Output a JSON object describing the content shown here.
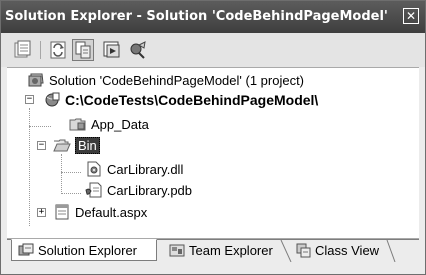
{
  "window": {
    "title": "Solution Explorer - Solution 'CodeBehindPageModel' ...",
    "close_glyph": "✕"
  },
  "toolbar": {
    "buttons": [
      {
        "name": "properties-icon"
      },
      {
        "name": "refresh-icon"
      },
      {
        "name": "show-all-files-icon"
      },
      {
        "name": "view-code-icon"
      },
      {
        "name": "copy-website-icon"
      }
    ]
  },
  "tree": {
    "solution": "Solution 'CodeBehindPageModel' (1 project)",
    "project": "C:\\CodeTests\\CodeBehindPageModel\\",
    "app_data": "App_Data",
    "bin": "Bin",
    "car_dll": "CarLibrary.dll",
    "car_pdb": "CarLibrary.pdb",
    "default_aspx": "Default.aspx",
    "expander_open": "−",
    "expander_closed": "+"
  },
  "tabs": [
    {
      "label": "Solution Explorer",
      "active": true
    },
    {
      "label": "Team Explorer",
      "active": false
    },
    {
      "label": "Class View",
      "active": false
    }
  ],
  "colors": {
    "titlebar": "#4a4a4a",
    "selection": "#3c3c3c"
  }
}
